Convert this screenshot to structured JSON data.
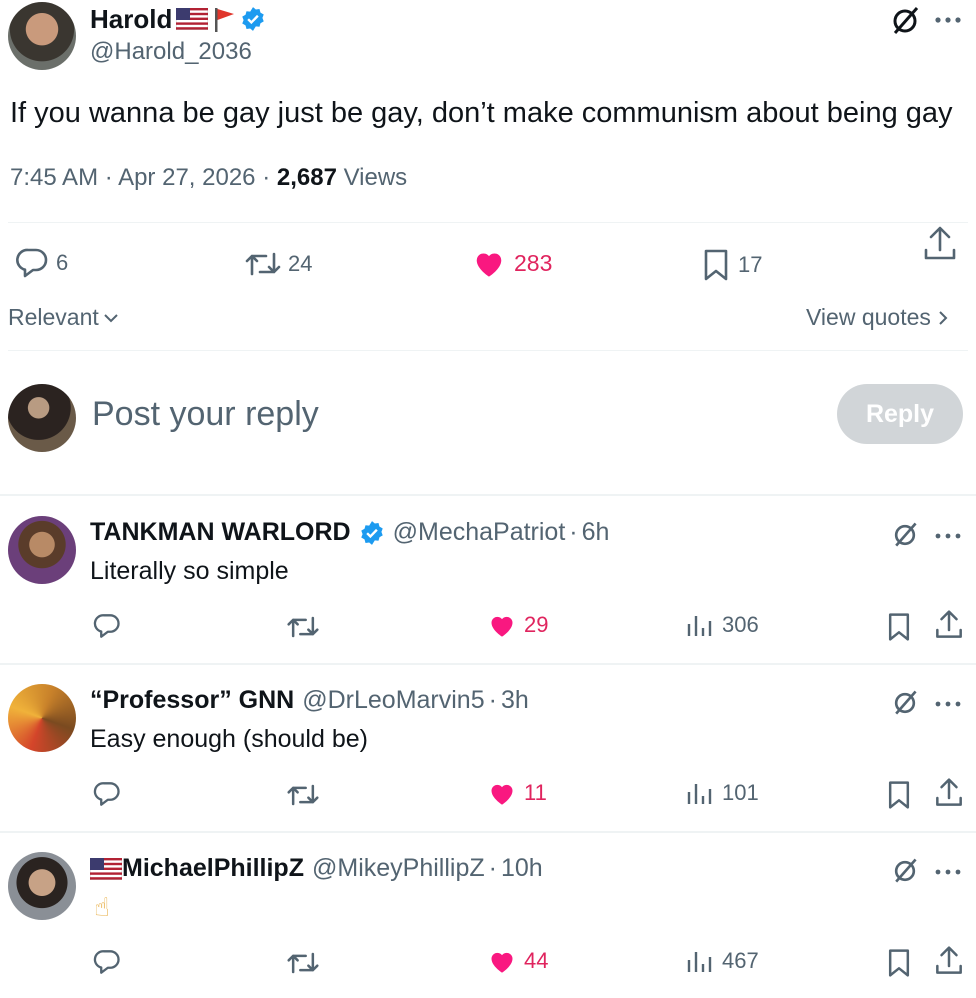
{
  "post": {
    "author_name": "Harold",
    "author_handle": "@Harold_2036",
    "text": "If you wanna be gay just be gay, don’t make communism about being gay",
    "time": "7:45 AM",
    "date": "Apr 27, 2026",
    "views_count": "2,687",
    "views_label": "Views",
    "replies": "6",
    "reposts": "24",
    "likes": "283",
    "bookmarks": "17"
  },
  "sort": {
    "label": "Relevant",
    "quotes_label": "View quotes"
  },
  "composer": {
    "placeholder": "Post your reply",
    "button": "Reply"
  },
  "replies": [
    {
      "name": "TANKMAN WARLORD",
      "handle": "@MechaPatriot",
      "time": "6h",
      "text": "Literally so simple",
      "likes": "29",
      "views": "306"
    },
    {
      "name": "“Professor” GNN",
      "handle": "@DrLeoMarvin5",
      "time": "3h",
      "text": "Easy enough (should be)",
      "likes": "11",
      "views": "101"
    },
    {
      "name": "MichaelPhillipZ",
      "handle": "@MikeyPhillipZ",
      "time": "10h",
      "text": "☝",
      "likes": "44",
      "views": "467"
    }
  ],
  "separators": {
    "dot": "·"
  },
  "colors": {
    "accent": "#1d9bf0",
    "like": "#f91880",
    "muted": "#536471",
    "reply_button": "#d1d5d8"
  }
}
